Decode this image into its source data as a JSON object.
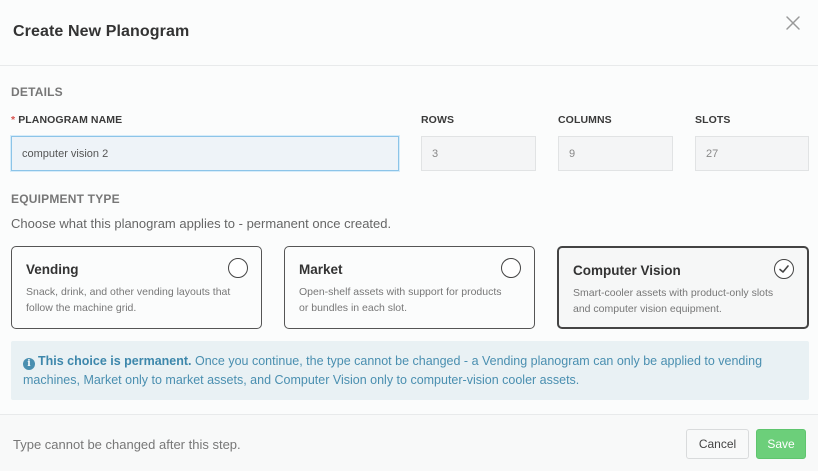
{
  "dialog": {
    "title": "Create New Planogram",
    "close_icon": "close-icon"
  },
  "details": {
    "section_label": "DETAILS",
    "name_label": "PLANOGRAM NAME",
    "name_required_marker": "*",
    "name_value": "computer vision 2",
    "rows_label": "ROWS",
    "rows_value": "3",
    "columns_label": "COLUMNS",
    "columns_value": "9",
    "slots_label": "SLOTS",
    "slots_value": "27"
  },
  "equipment": {
    "section_label": "EQUIPMENT TYPE",
    "subtext": "Choose what this planogram applies to - permanent once created.",
    "options": [
      {
        "title": "Vending",
        "description": "Snack, drink, and other vending layouts that follow the machine grid.",
        "selected": false
      },
      {
        "title": "Market",
        "description": "Open-shelf assets with support for products or bundles in each slot.",
        "selected": false
      },
      {
        "title": "Computer Vision",
        "description": "Smart-cooler assets with product-only slots and computer vision equipment.",
        "selected": true
      }
    ]
  },
  "notice": {
    "icon": "info-icon",
    "bold_text": "This choice is permanent.",
    "body_text": " Once you continue, the type cannot be changed - a Vending planogram can only be applied to vending machines, Market only to market assets, and Computer Vision only to computer-vision cooler assets."
  },
  "footer": {
    "note": "Type cannot be changed after this step.",
    "cancel_label": "Cancel",
    "save_label": "Save"
  },
  "colors": {
    "accent_save": "#6ccf7a",
    "notice_bg": "#e9f1f4",
    "notice_text": "#4a8fb0",
    "required": "#d9534f"
  }
}
